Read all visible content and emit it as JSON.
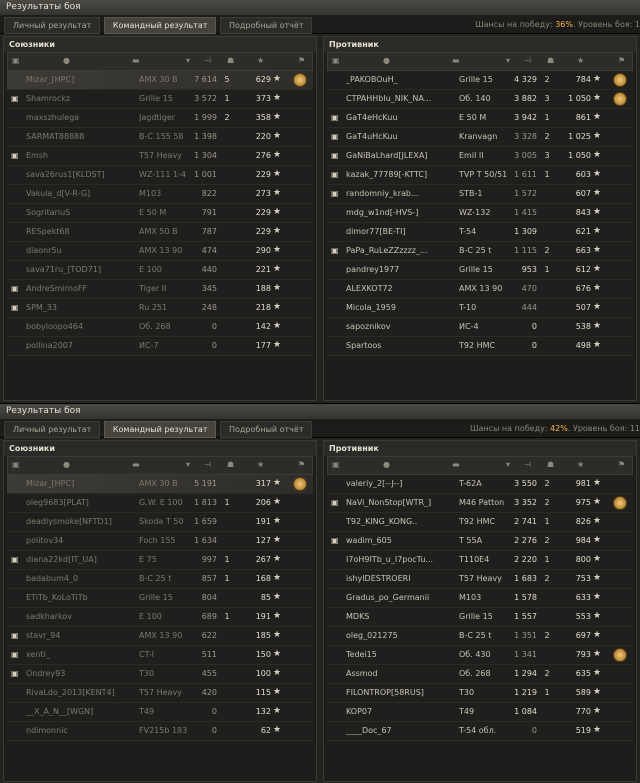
{
  "window1": {
    "title": "Результаты боя",
    "tabs": [
      "Личный результат",
      "Командный результат",
      "Подробный отчёт"
    ],
    "odds_prefix": "Шансы на победу: ",
    "odds_pct": "36%",
    "odds_suffix": ". Уровень боя: 1",
    "allies_title": "Союзники",
    "enemies_title": "Противник",
    "allies": [
      {
        "name": "Mizar_[HPC]",
        "vehicle": "AMX 30 B",
        "dmg": "7 614",
        "kills": "5",
        "exp": "629",
        "medal": true,
        "self": true,
        "dead": true
      },
      {
        "name": "Shamrockz",
        "vehicle": "Grille 15",
        "dmg": "3 572",
        "kills": "1",
        "exp": "373",
        "platoon": true,
        "dead": true
      },
      {
        "name": "maxszhulega",
        "vehicle": "Jagdtiger",
        "dmg": "1 999",
        "kills": "2",
        "exp": "358",
        "dead": true
      },
      {
        "name": "SARMAT88888",
        "vehicle": "B-C 155 58",
        "dmg": "1 398",
        "kills": "",
        "exp": "220",
        "dead": true
      },
      {
        "name": "Emsh",
        "vehicle": "T57 Heavy",
        "dmg": "1 304",
        "kills": "",
        "exp": "276",
        "platoon": true,
        "dead": true
      },
      {
        "name": "sava26rus1[KLDST]",
        "vehicle": "WZ-111 1-4",
        "dmg": "1 001",
        "kills": "",
        "exp": "229",
        "dead": true
      },
      {
        "name": "Vakula_d[V-R-G]",
        "vehicle": "M103",
        "dmg": "822",
        "kills": "",
        "exp": "273",
        "dead": true
      },
      {
        "name": "SogritariuS",
        "vehicle": "E 50 M",
        "dmg": "791",
        "kills": "",
        "exp": "229",
        "dead": true
      },
      {
        "name": "RESpekt68",
        "vehicle": "AMX 50 B",
        "dmg": "787",
        "kills": "",
        "exp": "229",
        "dead": true
      },
      {
        "name": "diaonr5u",
        "vehicle": "AMX 13 90",
        "dmg": "474",
        "kills": "",
        "exp": "290",
        "dead": true
      },
      {
        "name": "sava71ru_[TOD71]",
        "vehicle": "E 100",
        "dmg": "440",
        "kills": "",
        "exp": "221",
        "dead": true
      },
      {
        "name": "AndreSmirnoFF",
        "vehicle": "Tiger II",
        "dmg": "345",
        "kills": "",
        "exp": "188",
        "platoon": true,
        "dead": true
      },
      {
        "name": "SPM_33",
        "vehicle": "Ru 251",
        "dmg": "248",
        "kills": "",
        "exp": "218",
        "platoon": true,
        "dead": true
      },
      {
        "name": "bobyloopo464",
        "vehicle": "Об. 268",
        "dmg": "0",
        "kills": "",
        "exp": "142",
        "dead": true
      },
      {
        "name": "pollina2007",
        "vehicle": "ИС-7",
        "dmg": "0",
        "kills": "",
        "exp": "177",
        "dead": true
      }
    ],
    "enemies": [
      {
        "name": "_PAKOBOuH_",
        "vehicle": "Grille 15",
        "dmg": "4 329",
        "kills": "2",
        "exp": "784",
        "medal": true,
        "alive": true
      },
      {
        "name": "CTPAHHbIu_NIK_NA...",
        "vehicle": "Об. 140",
        "dmg": "3 882",
        "kills": "3",
        "exp": "1 050",
        "medal": true,
        "alive": true
      },
      {
        "name": "GaT4eHcKuu",
        "vehicle": "E 50 M",
        "dmg": "3 942",
        "kills": "1",
        "exp": "861",
        "platoon": true,
        "alive": true
      },
      {
        "name": "GaT4uHcKuu",
        "vehicle": "Kranvagn",
        "dmg": "3 328",
        "kills": "2",
        "exp": "1 025",
        "platoon": true
      },
      {
        "name": "GaNiBaLhard[JLEXA]",
        "vehicle": "Emil II",
        "dmg": "3 005",
        "kills": "3",
        "exp": "1 050",
        "platoon": true
      },
      {
        "name": "kazak_77789[-KTTC]",
        "vehicle": "TVP T 50/51",
        "dmg": "1 611",
        "kills": "1",
        "exp": "603",
        "platoon": true
      },
      {
        "name": "randomniy_krab...",
        "vehicle": "STB-1",
        "dmg": "1 572",
        "kills": "",
        "exp": "607",
        "platoon": true
      },
      {
        "name": "mdg_w1nd[-HVS-]",
        "vehicle": "WZ-132",
        "dmg": "1 415",
        "kills": "",
        "exp": "843"
      },
      {
        "name": "dimor77[BE-TI]",
        "vehicle": "T-54",
        "dmg": "1 309",
        "kills": "",
        "exp": "621",
        "alive": true
      },
      {
        "name": "PaPa_RuLeZZzzzz_...",
        "vehicle": "B-C 25 t",
        "dmg": "1 115",
        "kills": "2",
        "exp": "663",
        "platoon": true
      },
      {
        "name": "pandrey1977",
        "vehicle": "Grille 15",
        "dmg": "953",
        "kills": "1",
        "exp": "612",
        "alive": true
      },
      {
        "name": "ALEXKOT72",
        "vehicle": "AMX 13 90",
        "dmg": "470",
        "kills": "",
        "exp": "676"
      },
      {
        "name": "Micola_1959",
        "vehicle": "T-10",
        "dmg": "444",
        "kills": "",
        "exp": "507"
      },
      {
        "name": "sapoznikov",
        "vehicle": "ИС-4",
        "dmg": "0",
        "kills": "",
        "exp": "538",
        "alive": true
      },
      {
        "name": "Spartoos",
        "vehicle": "T92 HMC",
        "dmg": "0",
        "kills": "",
        "exp": "498",
        "alive": true
      }
    ]
  },
  "window2": {
    "title": "Результаты боя",
    "tabs": [
      "Личный результат",
      "Командный результат",
      "Подробный отчёт"
    ],
    "odds_prefix": "Шансы на победу: ",
    "odds_pct": "42%",
    "odds_suffix": ". Уровень боя: 11",
    "allies_title": "Союзники",
    "enemies_title": "Противник",
    "allies": [
      {
        "name": "Mizar_[HPC]",
        "vehicle": "AMX 30 B",
        "dmg": "5 191",
        "kills": "",
        "exp": "317",
        "medal": true,
        "self": true,
        "dead": true
      },
      {
        "name": "oleg9683[PLAT]",
        "vehicle": "G.W. E 100",
        "dmg": "1 813",
        "kills": "1",
        "exp": "206",
        "dead": true
      },
      {
        "name": "deadlysmoke[NFTD1]",
        "vehicle": "Škoda T 50",
        "dmg": "1 659",
        "kills": "",
        "exp": "191",
        "dead": true
      },
      {
        "name": "politov34",
        "vehicle": "Foch 155",
        "dmg": "1 634",
        "kills": "",
        "exp": "127",
        "dead": true
      },
      {
        "name": "diana22kd[IT_UA]",
        "vehicle": "E 75",
        "dmg": "997",
        "kills": "1",
        "exp": "267",
        "platoon": true,
        "dead": true
      },
      {
        "name": "badabum4_0",
        "vehicle": "B-C 25 t",
        "dmg": "857",
        "kills": "1",
        "exp": "168",
        "dead": true
      },
      {
        "name": "ETiTb_KoLoTiTb",
        "vehicle": "Grille 15",
        "dmg": "804",
        "kills": "",
        "exp": "85",
        "dead": true
      },
      {
        "name": "sadkharkov",
        "vehicle": "E 100",
        "dmg": "689",
        "kills": "1",
        "exp": "191",
        "dead": true
      },
      {
        "name": "stavr_94",
        "vehicle": "AMX 13 90",
        "dmg": "622",
        "kills": "",
        "exp": "185",
        "platoon": true,
        "dead": true
      },
      {
        "name": "xenti_",
        "vehicle": "CT-I",
        "dmg": "511",
        "kills": "",
        "exp": "150",
        "platoon": true,
        "dead": true
      },
      {
        "name": "Ondrey93",
        "vehicle": "T30",
        "dmg": "455",
        "kills": "",
        "exp": "100",
        "platoon": true,
        "dead": true
      },
      {
        "name": "RivaLdo_2013[KENT4]",
        "vehicle": "T57 Heavy",
        "dmg": "420",
        "kills": "",
        "exp": "115",
        "dead": true
      },
      {
        "name": "__X_A_N__[WGN]",
        "vehicle": "T49",
        "dmg": "0",
        "kills": "",
        "exp": "132",
        "dead": true
      },
      {
        "name": "ndimonnic",
        "vehicle": "FV215b 183",
        "dmg": "0",
        "kills": "",
        "exp": "62",
        "dead": true
      }
    ],
    "enemies": [
      {
        "name": "valeriy_2[--J--]",
        "vehicle": "T-62A",
        "dmg": "3 550",
        "kills": "2",
        "exp": "981",
        "alive": true
      },
      {
        "name": "NaVi_NonStop[WTR_]",
        "vehicle": "M46 Patton",
        "dmg": "3 352",
        "kills": "2",
        "exp": "975",
        "medal": true,
        "platoon": true,
        "alive": true
      },
      {
        "name": "T92_KING_KONG..",
        "vehicle": "T92 HMC",
        "dmg": "2 741",
        "kills": "1",
        "exp": "826",
        "alive": true
      },
      {
        "name": "wadim_605",
        "vehicle": "T 55A",
        "dmg": "2 276",
        "kills": "2",
        "exp": "984",
        "platoon": true,
        "alive": true
      },
      {
        "name": "I7oH9ITb_u_I7pocTu...",
        "vehicle": "T110E4",
        "dmg": "2 220",
        "kills": "1",
        "exp": "800",
        "alive": true
      },
      {
        "name": "ishyIDESTROERI",
        "vehicle": "T57 Heavy",
        "dmg": "1 683",
        "kills": "2",
        "exp": "753",
        "alive": true
      },
      {
        "name": "Gradus_po_Germanii",
        "vehicle": "M103",
        "dmg": "1 578",
        "kills": "",
        "exp": "633",
        "alive": true
      },
      {
        "name": "MDKS",
        "vehicle": "Grille 15",
        "dmg": "1 557",
        "kills": "",
        "exp": "553",
        "alive": true
      },
      {
        "name": "oleg_021275",
        "vehicle": "B-C 25 t",
        "dmg": "1 351",
        "kills": "2",
        "exp": "697"
      },
      {
        "name": "Tedei15",
        "vehicle": "Об. 430",
        "dmg": "1 341",
        "kills": "",
        "exp": "793",
        "medal": true
      },
      {
        "name": "Assmod",
        "vehicle": "Об. 268",
        "dmg": "1 294",
        "kills": "2",
        "exp": "635",
        "alive": true
      },
      {
        "name": "FILONTROP[58RUS]",
        "vehicle": "T30",
        "dmg": "1 219",
        "kills": "1",
        "exp": "589",
        "alive": true
      },
      {
        "name": "KOP07",
        "vehicle": "T49",
        "dmg": "1 084",
        "kills": "",
        "exp": "770",
        "alive": true
      },
      {
        "name": "____Doc_67",
        "vehicle": "T-54 обл.",
        "dmg": "0",
        "kills": "",
        "exp": "519"
      }
    ]
  },
  "icons": {
    "star": "★",
    "platoon": "platoon-icon",
    "medal": "medal-icon"
  }
}
